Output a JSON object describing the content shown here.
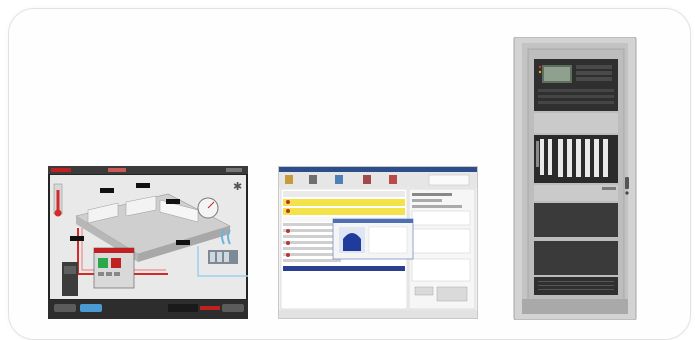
{
  "products": [
    {
      "id": "hmi-workstation",
      "icon": "hmi-touchscreen-icon",
      "screen_labels": []
    },
    {
      "id": "management-software",
      "icon": "software-window-icon",
      "screen_labels": []
    },
    {
      "id": "fire-panel-cabinet",
      "icon": "fire-panel-cabinet-icon",
      "screen_labels": []
    }
  ],
  "colors": {
    "frame_border": "#e2e2e2",
    "hmi_floor": "#d8d8d8",
    "hmi_accent_red": "#d42a2a",
    "sw_highlight": "#f4e24a",
    "sw_selection": "#2b3f8f",
    "cabinet_body": "#d3d3d3",
    "cabinet_door": "#b9b9b9",
    "cabinet_panel": "#3a3a3a"
  }
}
